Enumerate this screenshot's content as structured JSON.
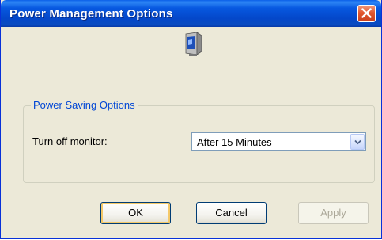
{
  "window": {
    "title": "Power Management Options"
  },
  "icons": {
    "close": "close-icon",
    "monitor": "monitor-icon",
    "dropdown": "chevron-down-icon"
  },
  "group": {
    "legend": "Power Saving Options",
    "turn_off_monitor_label": "Turn off monitor:",
    "turn_off_monitor_value": "After 15 Minutes"
  },
  "buttons": {
    "ok": "OK",
    "cancel": "Cancel",
    "apply": "Apply"
  },
  "colors": {
    "titlebar": "#0447c9",
    "close_button": "#e2572e",
    "legend_text": "#0046d5",
    "window_background": "#ece9d8"
  }
}
